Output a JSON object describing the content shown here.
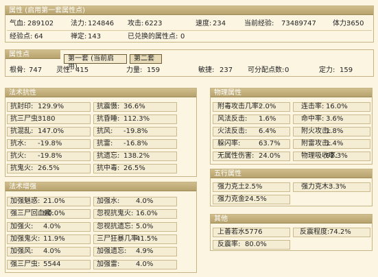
{
  "main": {
    "title": "属性 (启用第一套属性点)",
    "row1": [
      {
        "label": "气血:",
        "value": "289102"
      },
      {
        "label": "法力:",
        "value": "124846"
      },
      {
        "label": "攻击:",
        "value": "6223"
      },
      {
        "label": "速度:",
        "value": "234"
      },
      {
        "label": "当前经验:",
        "value": "73489747"
      },
      {
        "label": "体力:",
        "value": "3650"
      }
    ],
    "row2": [
      {
        "label": "经验点:",
        "value": "64"
      },
      {
        "label": "禅定:",
        "value": "143"
      },
      {
        "label": "已兑换的属性点:",
        "value": "0"
      }
    ]
  },
  "points": {
    "title": "属性点",
    "tabs": [
      "第一套 (当前启用)",
      "第二套"
    ],
    "row": [
      {
        "label": "根骨:",
        "value": "747"
      },
      {
        "label": "灵性:",
        "value": "415"
      },
      {
        "label": "力量:",
        "value": "159"
      },
      {
        "label": "敏捷:",
        "value": "237"
      },
      {
        "label": "可分配点数:",
        "value": "0"
      },
      {
        "label": "定力:",
        "value": "159"
      }
    ]
  },
  "resist": {
    "title": "法术抗性",
    "rows": [
      [
        {
          "label": "抗封印:",
          "value": "129.9%"
        },
        {
          "label": "抗震慑:",
          "value": "36.6%"
        }
      ],
      [
        {
          "label": "抗三尸虫:",
          "value": "3180"
        },
        {
          "label": "抗昏睡:",
          "value": "112.3%"
        }
      ],
      [
        {
          "label": "抗混乱:",
          "value": "147.0%"
        },
        {
          "label": "抗风:",
          "value": "-19.8%"
        }
      ],
      [
        {
          "label": "抗水:",
          "value": "-19.8%"
        },
        {
          "label": "抗雷:",
          "value": "-16.8%"
        }
      ],
      [
        {
          "label": "抗火:",
          "value": "-19.8%"
        },
        {
          "label": "抗遗忘:",
          "value": "138.2%"
        }
      ],
      [
        {
          "label": "抗鬼火:",
          "value": "26.5%"
        },
        {
          "label": "抗中毒:",
          "value": "26.5%"
        }
      ]
    ]
  },
  "boost": {
    "title": "法术增强",
    "rows": [
      [
        {
          "label": "加强魅惑:",
          "value": "21.0%"
        },
        {
          "label": "加强水:",
          "value": "4.0%"
        }
      ],
      [
        {
          "label": "强三尸回血度:",
          "value": "90.0%"
        },
        {
          "label": "忽视抗鬼火:",
          "value": "16.0%"
        }
      ],
      [
        {
          "label": "加强火:",
          "value": "4.0%"
        },
        {
          "label": "忽视抗遗忘:",
          "value": "5.0%"
        }
      ],
      [
        {
          "label": "加强鬼火:",
          "value": "11.9%"
        },
        {
          "label": "三尸狂暴几率:",
          "value": "41.5%"
        }
      ],
      [
        {
          "label": "加强风:",
          "value": "4.0%"
        },
        {
          "label": "加强遗忘:",
          "value": "4.9%"
        }
      ],
      [
        {
          "label": "强三尸虫:",
          "value": "5544"
        },
        {
          "label": "加强雷:",
          "value": "4.0%"
        }
      ]
    ]
  },
  "physical": {
    "title": "物理属性",
    "rows": [
      [
        {
          "label": "附毒攻击几率:",
          "value": "2.0%"
        },
        {
          "label": "连击率:",
          "value": "16.0%"
        }
      ],
      [
        {
          "label": "风法反击:",
          "value": "1.6%"
        },
        {
          "label": "命中率:",
          "value": "3.6%"
        }
      ],
      [
        {
          "label": "火法反击:",
          "value": "6.4%"
        },
        {
          "label": "附火攻击:",
          "value": "1.8%"
        }
      ],
      [
        {
          "label": "躲闪率:",
          "value": "63.7%"
        },
        {
          "label": "附雷攻击:",
          "value": "1.4%"
        }
      ],
      [
        {
          "label": "无属性伤害:",
          "value": "24.0%"
        },
        {
          "label": "物理吸收率:",
          "value": "92.3%"
        }
      ]
    ]
  },
  "wuxing": {
    "title": "五行属性",
    "rows": [
      [
        {
          "label": "强力克土:",
          "value": "2.5%"
        },
        {
          "label": "强力克木:",
          "value": "3.3%"
        }
      ],
      [
        {
          "label": "强力克金:",
          "value": "24.5%"
        }
      ]
    ]
  },
  "other": {
    "title": "其他",
    "rows": [
      [
        {
          "label": "上善若水:",
          "value": "5776"
        },
        {
          "label": "反震程度:",
          "value": "74.2%"
        }
      ],
      [
        {
          "label": "反震率:",
          "value": "80.0%"
        }
      ]
    ]
  }
}
